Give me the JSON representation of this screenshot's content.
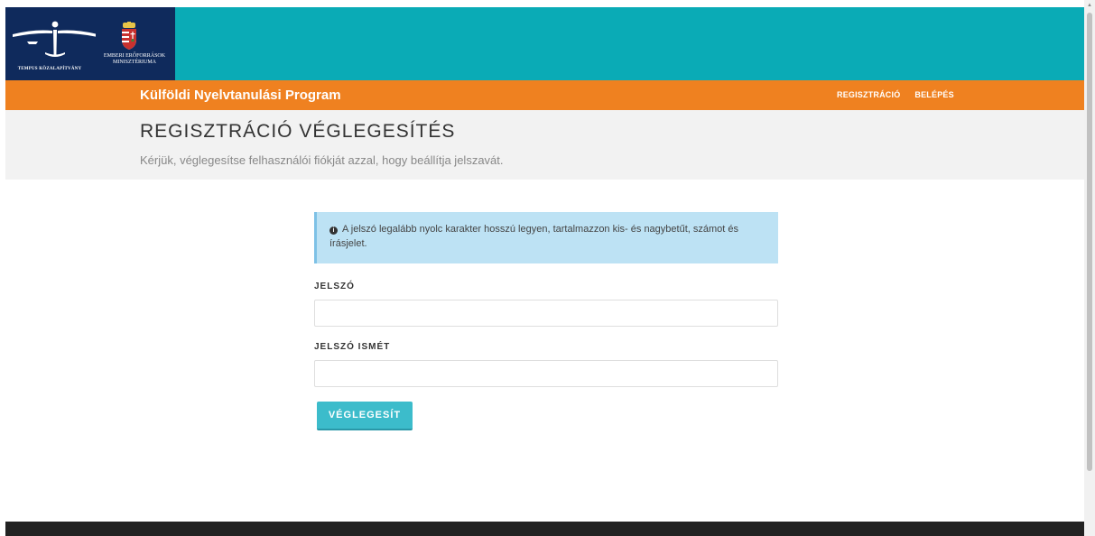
{
  "header": {
    "tempus_logo_text": "TEMPUS KÖZALAPÍTVÁNY",
    "emmi_line1": "EMBERI ERŐFORRÁSOK",
    "emmi_line2": "MINISZTÉRIUMA"
  },
  "navbar": {
    "brand": "Külföldi Nyelvtanulási Program",
    "links": [
      "REGISZTRÁCIÓ",
      "BELÉPÉS"
    ]
  },
  "page": {
    "title": "REGISZTRÁCIÓ VÉGLEGESÍTÉS",
    "subtitle": "Kérjük, véglegesítse felhasználói fiókját azzal, hogy beállítja jelszavát."
  },
  "form": {
    "info_text": "A jelszó legalább nyolc karakter hosszú legyen, tartalmazzon kis- és nagybetűt, számot és írásjelet.",
    "password_label": "JELSZÓ",
    "password_value": "",
    "password_confirm_label": "JELSZÓ ISMÉT",
    "password_confirm_value": "",
    "submit_label": "VÉGLEGESÍT"
  },
  "colors": {
    "banner": "#0aabb6",
    "logo_bg": "#0f2a5c",
    "navbar": "#ef8120",
    "alert_bg": "#bde2f4",
    "button": "#3cbccb",
    "footer": "#222222"
  },
  "icons": {
    "info": "info-circle-icon"
  }
}
